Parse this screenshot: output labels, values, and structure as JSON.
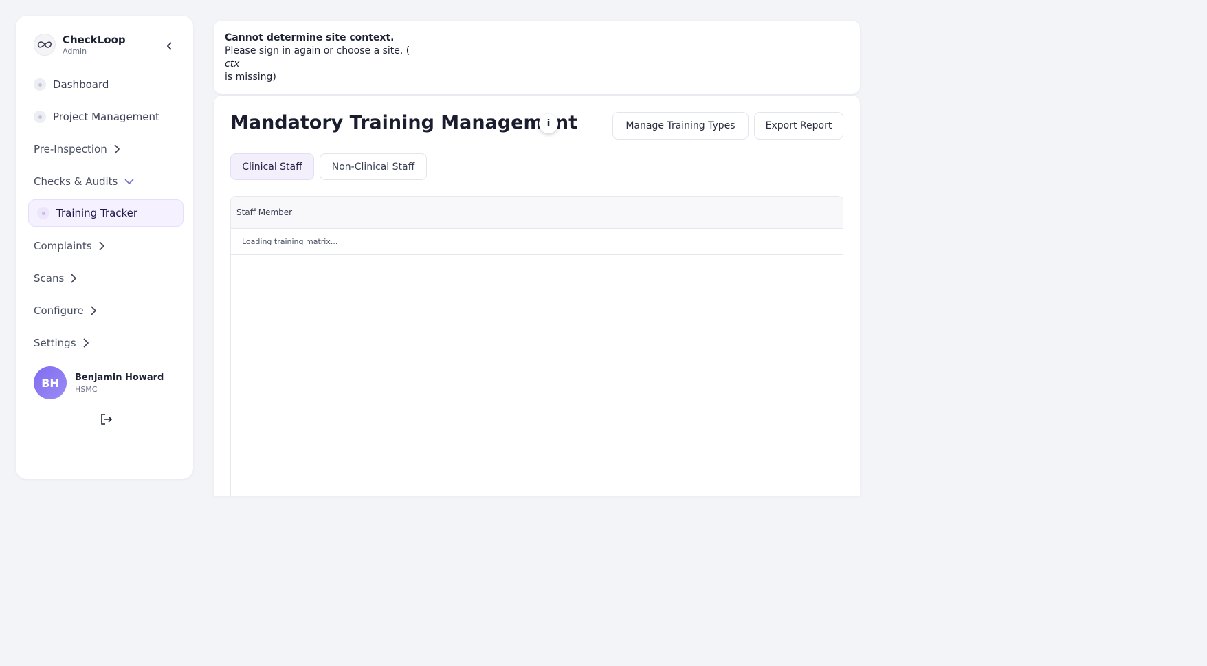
{
  "sidebar": {
    "brand_name": "CheckLoop",
    "brand_role": "Admin",
    "items": [
      {
        "label": "Dashboard"
      },
      {
        "label": "Project Management"
      },
      {
        "label": "Pre-Inspection"
      },
      {
        "label": "Checks & Audits"
      },
      {
        "label": "Training Tracker"
      },
      {
        "label": "Complaints"
      },
      {
        "label": "Scans"
      },
      {
        "label": "Configure"
      },
      {
        "label": "Settings"
      }
    ],
    "user": {
      "initials": "BH",
      "name": "Benjamin Howard",
      "org": "HSMC"
    }
  },
  "alert": {
    "title": "Cannot determine site context.",
    "line1": "Please sign in again or choose a site. (",
    "code": "ctx",
    "line2": "is missing)"
  },
  "main": {
    "title": "Mandatory Training Management",
    "info_label": "i",
    "manage_label": "Manage Training Types",
    "export_label": "Export Report",
    "tabs": [
      {
        "label": "Clinical Staff"
      },
      {
        "label": "Non-Clinical Staff"
      }
    ],
    "table": {
      "header": "Staff Member",
      "loading": "Loading training matrix..."
    }
  },
  "colors": {
    "background": "#f3f4f8",
    "accent": "#7f6cf0",
    "active_bg": "#f5f1ff"
  }
}
